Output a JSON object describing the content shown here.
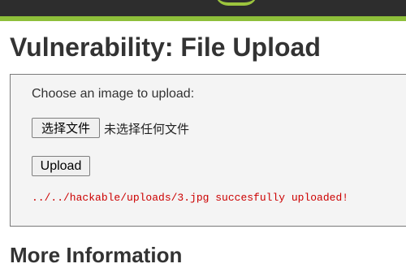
{
  "page": {
    "title": "Vulnerability: File Upload",
    "section_heading": "More Information"
  },
  "form": {
    "prompt": "Choose an image to upload:",
    "choose_file_label": "选择文件",
    "file_status": "未选择任何文件",
    "upload_label": "Upload",
    "result_message": "../../hackable/uploads/3.jpg succesfully uploaded!"
  },
  "colors": {
    "banner": "#2d2d2d",
    "accent": "#8ebf3a",
    "message": "#cc0000"
  }
}
